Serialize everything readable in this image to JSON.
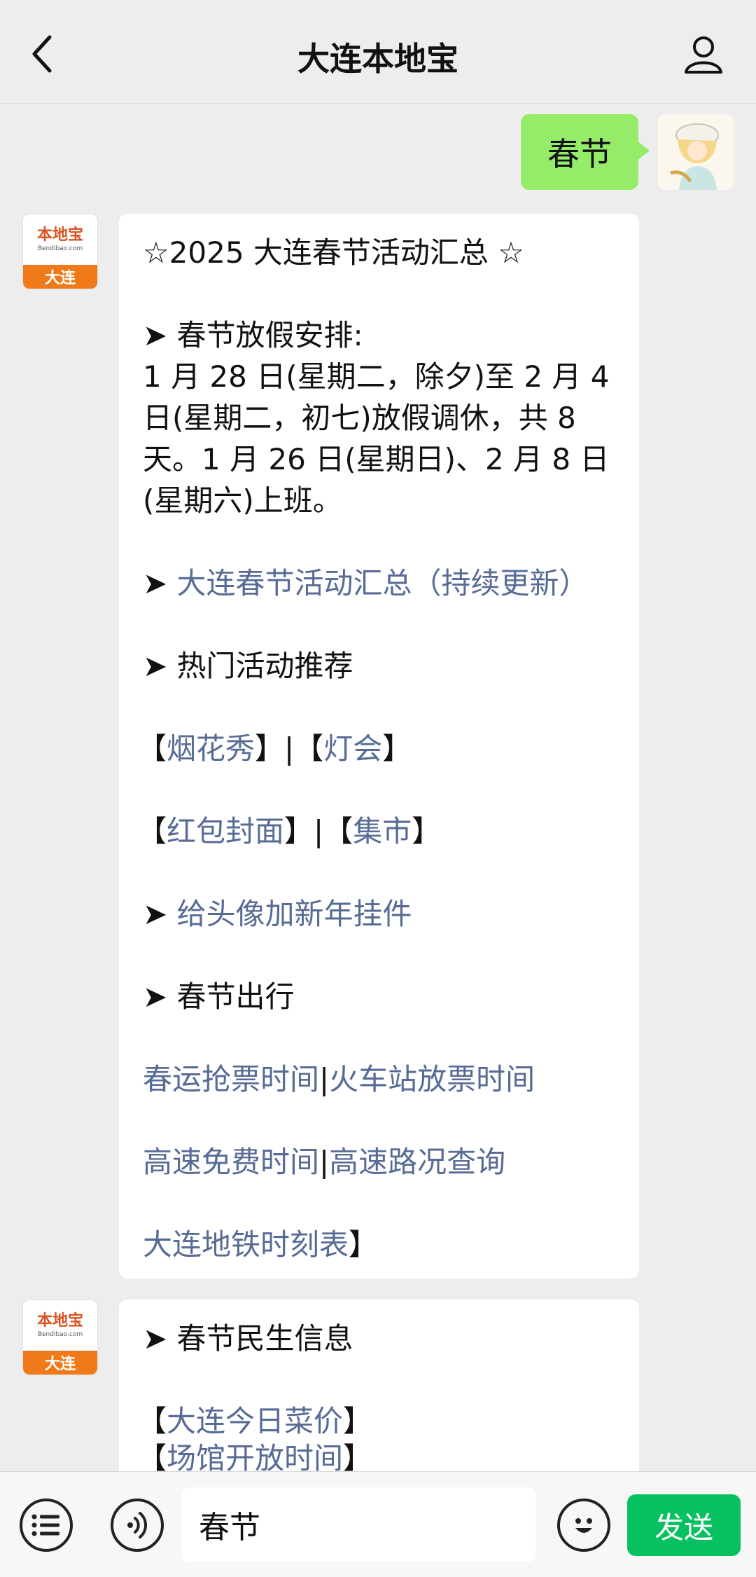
{
  "header": {
    "title": "大连本地宝"
  },
  "sent_message": {
    "text": "春节"
  },
  "account_avatar": {
    "brand": "本地宝",
    "url": "Bendibao.com",
    "city": "大连"
  },
  "message1": {
    "title": "☆2025 大连春节活动汇总 ☆",
    "holiday_heading": "春节放假安排:",
    "holiday_lines": [
      "1 月 28 日(星期二，除夕)至 2 月 4",
      "日(星期二，初七)放假调休，共 8",
      "天。1 月 26 日(星期日)、2 月 8 日",
      "(星期六)上班。"
    ],
    "summary_link": "大连春节活动汇总（持续更新）",
    "hot_heading": "热门活动推荐",
    "row1": {
      "open1": "【",
      "a": "烟花秀",
      "mid": "】|【",
      "b": "灯会",
      "close": "】"
    },
    "row2": {
      "open1": "【",
      "a": "红包封面",
      "mid": "】|【",
      "b": "集市",
      "close": "】"
    },
    "avatar_link": "给头像加新年挂件",
    "travel_heading": "春节出行",
    "travel_row1": {
      "a": "春运抢票时间",
      "sep": "|",
      "b": "火车站放票时间"
    },
    "travel_row2": {
      "a": "高速免费时间",
      "sep": "|",
      "b": "高速路况查询"
    },
    "metro": {
      "text": "大连地铁时刻表",
      "close": "】"
    }
  },
  "message2": {
    "heading": "春节民生信息",
    "item1": {
      "open": "【",
      "text": "大连今日菜价",
      "close": "】"
    },
    "item2": {
      "open": "【",
      "text": "场馆开放时间",
      "close": "】"
    }
  },
  "input_bar": {
    "value": "春节",
    "send_label": "发送"
  },
  "colors": {
    "link": "#576b95",
    "send": "#07c160",
    "bubble_sent": "#95ec69"
  },
  "icons": [
    "chevron-left-icon",
    "user-icon",
    "menu-list-icon",
    "voice-icon",
    "emoji-icon"
  ]
}
